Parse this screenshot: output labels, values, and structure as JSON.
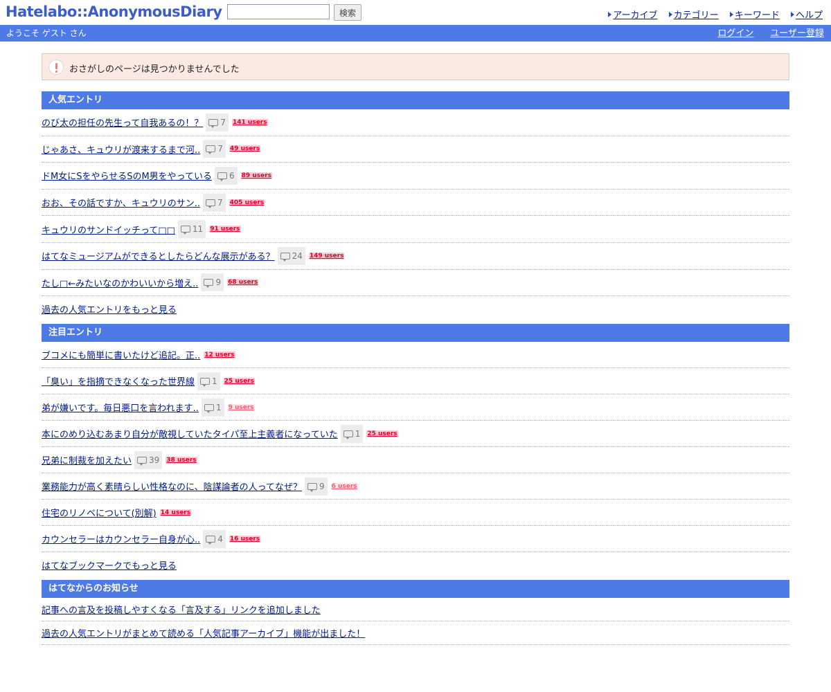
{
  "header": {
    "logo_part1": "Hatelabo::",
    "logo_part2": "AnonymousDiary",
    "search_button": "検索",
    "nav": [
      "アーカイブ",
      "カテゴリー",
      "キーワード",
      "ヘルプ"
    ]
  },
  "userbar": {
    "greeting": "ようこそ ゲスト さん",
    "login": "ログイン",
    "register": "ユーザー登録"
  },
  "alert": {
    "text": "おさがしのページは見つかりませんでした"
  },
  "popular": {
    "heading": "人気エントリ",
    "entries": [
      {
        "title": "のび太の担任の先生って自我あるの！？",
        "comments": "7",
        "users": "141 users"
      },
      {
        "title": "じゃあさ、キュウリが渡来するまで河..",
        "comments": "7",
        "users": "49 users"
      },
      {
        "title": "ドM女にSをやらせるSのM男をやっている",
        "comments": "6",
        "users": "89 users"
      },
      {
        "title": "おお、その話ですか、キュウリのサン..",
        "comments": "7",
        "users": "405 users"
      },
      {
        "title": "キュウリのサンドイッチって□□",
        "comments": "11",
        "users": "91 users"
      },
      {
        "title": "はてなミュージアムができるとしたらどんな展示がある？",
        "comments": "24",
        "users": "149 users"
      },
      {
        "title": "たし□←みたいなのかわいいから増え..",
        "comments": "9",
        "users": "68 users"
      }
    ],
    "more": "過去の人気エントリをもっと見る"
  },
  "featured": {
    "heading": "注目エントリ",
    "entries": [
      {
        "title": "ブコメにも簡単に書いたけど追記。正..",
        "comments": "",
        "users": "12 users"
      },
      {
        "title": "「臭い」を指摘できなくなった世界線",
        "comments": "1",
        "users": "25 users"
      },
      {
        "title": "弟が嫌いです。毎日悪口を言われます..",
        "comments": "1",
        "users": "9 users"
      },
      {
        "title": "本にのめり込むあまり自分が敵視していたタイパ至上主義者になっていた",
        "comments": "1",
        "users": "25 users"
      },
      {
        "title": "兄弟に制裁を加えたい",
        "comments": "39",
        "users": "38 users"
      },
      {
        "title": "業務能力が高く素晴らしい性格なのに、陰謀論者の人ってなぜ？",
        "comments": "9",
        "users": "6 users"
      },
      {
        "title": "住宅のリノベについて(別解)",
        "comments": "",
        "users": "14 users"
      },
      {
        "title": "カウンセラーはカウンセラー自身が心..",
        "comments": "4",
        "users": "16 users"
      }
    ],
    "more": "はてなブックマークでもっと見る"
  },
  "news": {
    "heading": "はてなからのお知らせ",
    "entries": [
      {
        "title": "記事への言及を投稿しやすくなる「言及する」リンクを追加しました"
      },
      {
        "title": "過去の人気エントリがまとめて読める「人気記事アーカイブ」機能が出ました！"
      }
    ]
  }
}
